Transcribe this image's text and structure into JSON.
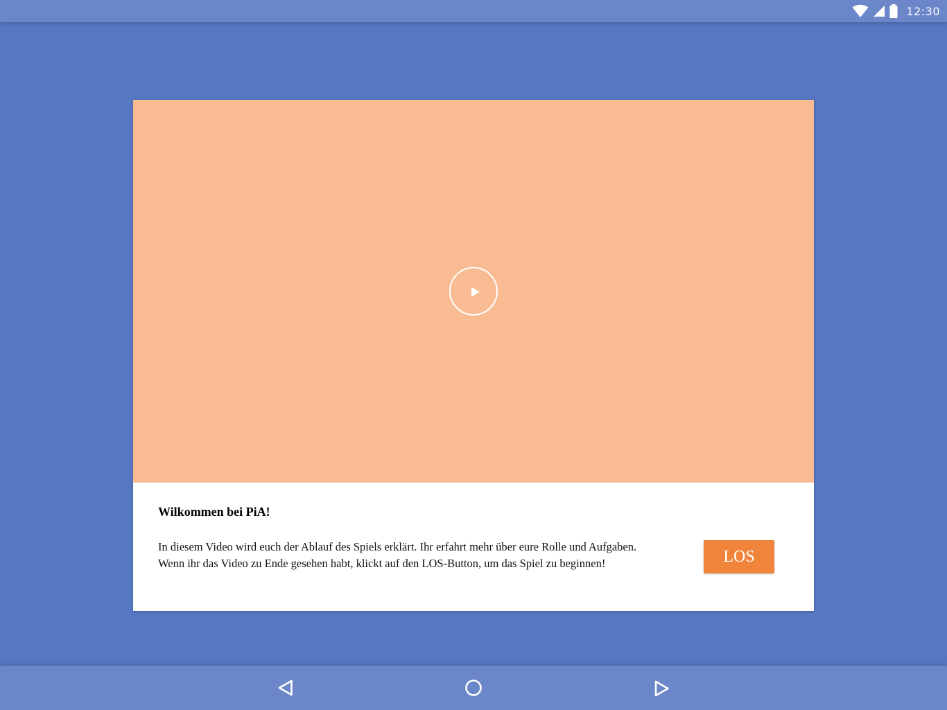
{
  "status_bar": {
    "time": "12:30",
    "icons": [
      "wifi-icon",
      "cell-signal-icon",
      "battery-icon"
    ]
  },
  "video": {
    "background_color": "#f8bb92",
    "play_icon": "play-icon"
  },
  "card": {
    "title": "Wilkommen bei PiA!",
    "description_line1": "In diesem Video wird euch der Ablauf des Spiels erklärt. Ihr erfahrt mehr über eure Rolle und Aufgaben.",
    "description_line2": "Wenn ihr das Video zu Ende gesehen habt, klickt auf den LOS-Button, um das Spiel zu beginnen!",
    "button_label": "LOS",
    "button_color": "#f0843a"
  },
  "nav_bar": {
    "icons": [
      "back-triangle-icon",
      "home-circle-icon",
      "forward-triangle-icon"
    ]
  },
  "colors": {
    "background": "#5677c1",
    "bars": "#6b87c9"
  }
}
